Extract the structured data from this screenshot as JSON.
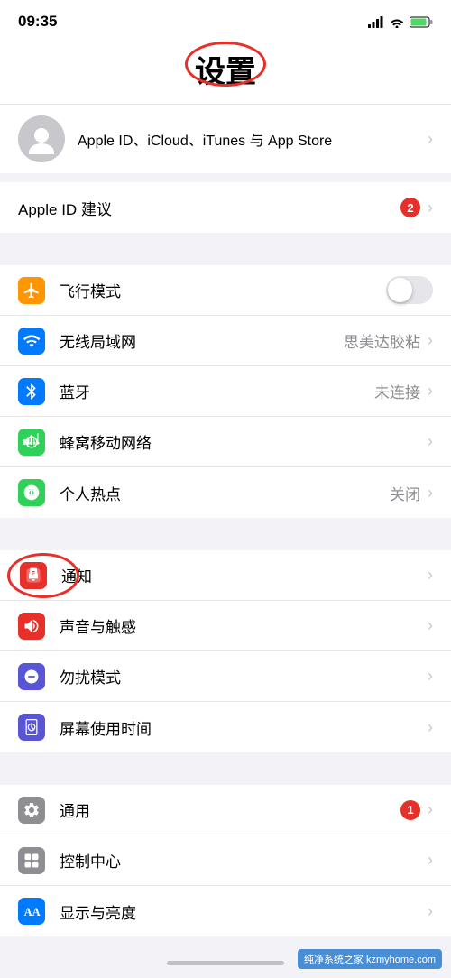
{
  "statusBar": {
    "time": "09:35"
  },
  "header": {
    "title": "设置",
    "title_circle": true
  },
  "appleId": {
    "subtitle": "Apple ID、iCloud、iTunes 与 App Store"
  },
  "suggestionRow": {
    "label": "Apple ID 建议",
    "badge": "2"
  },
  "section1": [
    {
      "id": "airplane",
      "label": "飞行模式",
      "value": "",
      "hasToggle": true,
      "toggleOn": false,
      "iconBg": "#ff9500",
      "iconType": "airplane"
    },
    {
      "id": "wifi",
      "label": "无线局域网",
      "value": "思美达胶粘",
      "hasToggle": false,
      "iconBg": "#007aff",
      "iconType": "wifi"
    },
    {
      "id": "bluetooth",
      "label": "蓝牙",
      "value": "未连接",
      "hasToggle": false,
      "iconBg": "#007aff",
      "iconType": "bluetooth"
    },
    {
      "id": "cellular",
      "label": "蜂窝移动网络",
      "value": "",
      "hasToggle": false,
      "iconBg": "#30d158",
      "iconType": "cellular"
    },
    {
      "id": "hotspot",
      "label": "个人热点",
      "value": "关闭",
      "hasToggle": false,
      "iconBg": "#30d158",
      "iconType": "hotspot"
    }
  ],
  "section2": [
    {
      "id": "notification",
      "label": "通知",
      "value": "",
      "hasToggle": false,
      "iconBg": "#e8302a",
      "iconType": "notification",
      "hasCircle": true
    },
    {
      "id": "sound",
      "label": "声音与触感",
      "value": "",
      "hasToggle": false,
      "iconBg": "#e8302a",
      "iconType": "sound"
    },
    {
      "id": "dnd",
      "label": "勿扰模式",
      "value": "",
      "hasToggle": false,
      "iconBg": "#5856d6",
      "iconType": "dnd"
    },
    {
      "id": "screentime",
      "label": "屏幕使用时间",
      "value": "",
      "hasToggle": false,
      "iconBg": "#5856d6",
      "iconType": "screentime"
    }
  ],
  "section3": [
    {
      "id": "general",
      "label": "通用",
      "value": "",
      "badge": "1",
      "hasToggle": false,
      "iconBg": "#8e8e93",
      "iconType": "general"
    },
    {
      "id": "control",
      "label": "控制中心",
      "value": "",
      "hasToggle": false,
      "iconBg": "#8e8e93",
      "iconType": "control"
    },
    {
      "id": "display",
      "label": "显示与亮度",
      "value": "",
      "hasToggle": false,
      "iconBg": "#007aff",
      "iconType": "display"
    }
  ],
  "watermark": "纯净系统之家 kzmyhome.com"
}
